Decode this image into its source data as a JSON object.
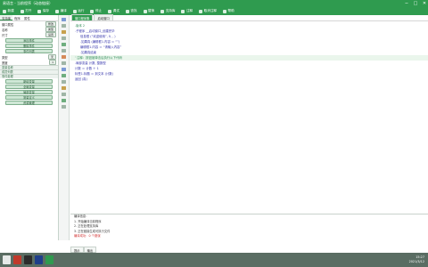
{
  "window": {
    "title": "易语言 - 当前程序（动态链接）",
    "minimize_glyph": "−",
    "maximize_glyph": "□",
    "close_glyph": "✕"
  },
  "toolbar": {
    "items": [
      "新建",
      "打开",
      "保存",
      "编译",
      "运行",
      "停止",
      "调试",
      "查找",
      "替换",
      "支持库",
      "注释",
      "取消注释",
      "帮助"
    ]
  },
  "left_panel": {
    "tabs": [
      "支持库",
      "程序",
      "属性"
    ],
    "rows": [
      {
        "label": "窗口属性",
        "btn": "修改"
      },
      {
        "label": "名称",
        "btn": "类型"
      },
      {
        "label": "尺寸",
        "btn": "设置"
      }
    ],
    "green_buttons": [
      "添加事件",
      "删除事件",
      "事件列表"
    ],
    "fields": [
      {
        "label": "类型",
        "value": "无"
      },
      {
        "label": "宽度",
        "value": "1"
      }
    ],
    "section_headers": [
      "变量名称",
      "成员列表",
      "事件处理"
    ],
    "green_buttons_2": [
      "新增变量",
      "全局变量",
      "局部变量",
      "常量定义",
      "资源管理"
    ]
  },
  "editor": {
    "tabs": [
      "窗口程序集",
      "启动窗口"
    ],
    "lines": [
      {
        "text": ".版本 2",
        "cls": "cm"
      },
      {
        "text": ".子程序 __启动窗口_创建完毕",
        "cls": ""
      },
      {
        "text": "信息框 (“欢迎使用”, 0, , )",
        "cls": "ind"
      },
      {
        "text": ".如果真 (编辑框1.内容 ＝ “”)",
        "cls": "ind"
      },
      {
        "text": "编辑框1.内容 ＝ “请输入内容”",
        "cls": "ind"
      },
      {
        "text": ".如果真结束",
        "cls": "ind"
      },
      {
        "text": "' 注释：按钮被单击后执行以下代码",
        "cls": "cm hl"
      },
      {
        "text": ".局部变量 计数, 整数型",
        "cls": ""
      },
      {
        "text": "计数 ＝ 计数 ＋ 1",
        "cls": ""
      },
      {
        "text": "标签1.标题 ＝ 到文本 (计数)",
        "cls": ""
      },
      {
        "text": "返回 (真)",
        "cls": ""
      }
    ]
  },
  "output": {
    "lines": [
      {
        "text": "编译信息：",
        "cls": ""
      },
      {
        "text": "1. 开始编译当前程序",
        "cls": ""
      },
      {
        "text": "2. 正在处理支持库",
        "cls": ""
      },
      {
        "text": "3. 正在链接生成可执行文件",
        "cls": ""
      },
      {
        "text": "编译成功：0 个错误",
        "cls": "red"
      }
    ],
    "tabs": [
      "提示",
      "输出"
    ]
  },
  "taskbar": {
    "time": "15:27",
    "date": "2021/3/12"
  },
  "colors": {
    "accent": "#2f9b4f",
    "taskbar": "#5a6d63"
  }
}
